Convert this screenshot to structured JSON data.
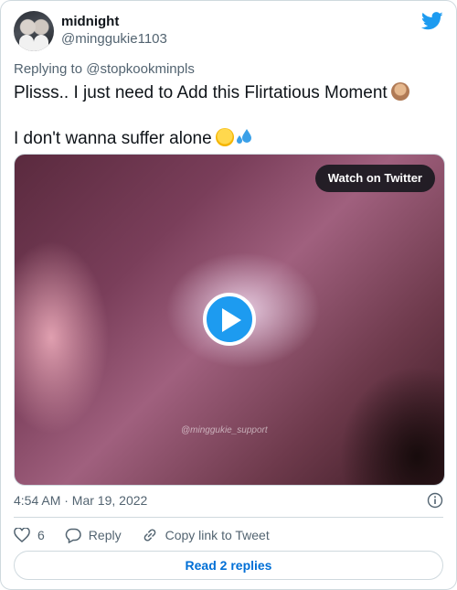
{
  "user": {
    "display_name": "midnight",
    "handle": "@minggukie1103"
  },
  "reply_to": "Replying to @stopkookminpls",
  "tweet": {
    "line1": "Plisss.. I just need to Add this Flirtatious Moment",
    "line2": "I don't wanna suffer alone"
  },
  "media": {
    "watch_label": "Watch on Twitter",
    "watermark": "@minggukie_support"
  },
  "timestamp": "4:54 AM · Mar 19, 2022",
  "actions": {
    "likes": "6",
    "reply_label": "Reply",
    "copy_label": "Copy link to Tweet"
  },
  "read_replies": "Read 2 replies",
  "colors": {
    "accent": "#1d9bf0",
    "link": "#006fd6",
    "muted": "#536471",
    "border": "#cfd9de"
  },
  "icons": [
    "twitter-bird-icon",
    "see-no-evil-monkey-emoji",
    "pleading-face-emoji",
    "sweat-droplets-emoji",
    "play-icon",
    "info-icon",
    "heart-icon",
    "reply-icon",
    "link-icon"
  ]
}
